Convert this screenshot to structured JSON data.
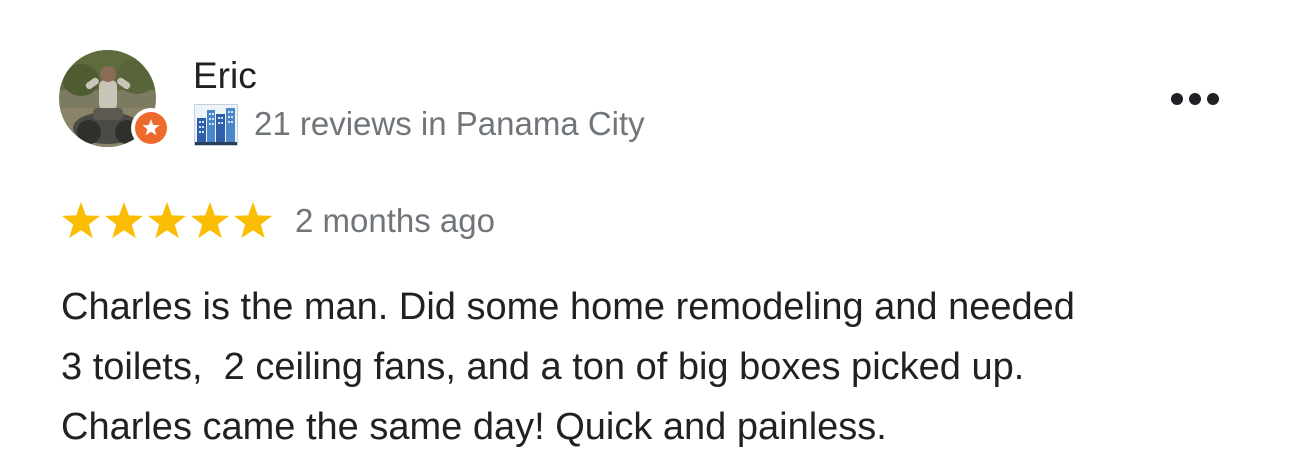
{
  "reviewer": {
    "name": "Eric",
    "meta": "21 reviews in Panama City",
    "avatar_icon": "reviewer-avatar-photo",
    "badge_icon": "local-guide-badge-icon",
    "meta_icon": "city-skyline-icon"
  },
  "menu": {
    "icon": "more-options-icon"
  },
  "review": {
    "rating": 5,
    "rating_max": 5,
    "time": "2 months ago",
    "text_lines": [
      "Charles is the man. Did some home remodeling and needed",
      "3 toilets,  2 ceiling fans, and a ton of big boxes picked up.",
      "Charles came the same day! Quick and painless."
    ]
  },
  "colors": {
    "star": "#fbbc04",
    "star_empty": "#dadce0",
    "badge": "#ee6a2c",
    "secondary_text": "#70757a",
    "primary_text": "#202124"
  }
}
